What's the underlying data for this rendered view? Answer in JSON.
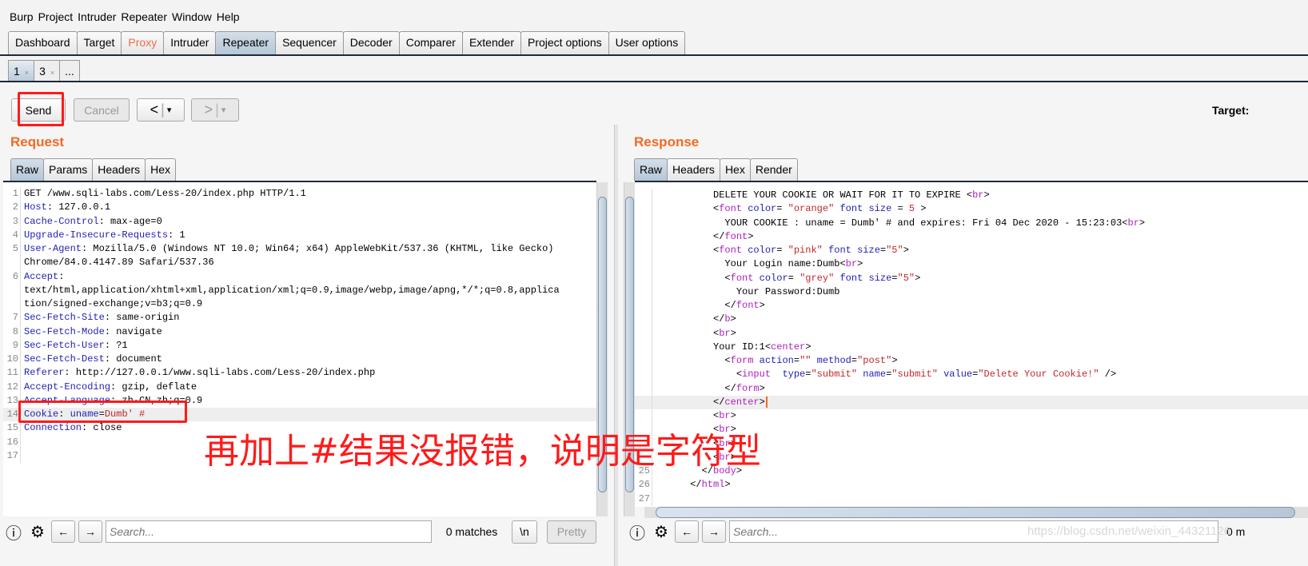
{
  "menu": [
    "Burp",
    "Project",
    "Intruder",
    "Repeater",
    "Window",
    "Help"
  ],
  "main_tabs": [
    {
      "label": "Dashboard"
    },
    {
      "label": "Target"
    },
    {
      "label": "Proxy",
      "color": "#f26b4a"
    },
    {
      "label": "Intruder"
    },
    {
      "label": "Repeater",
      "active": true
    },
    {
      "label": "Sequencer"
    },
    {
      "label": "Decoder"
    },
    {
      "label": "Comparer"
    },
    {
      "label": "Extender"
    },
    {
      "label": "Project options"
    },
    {
      "label": "User options"
    }
  ],
  "repeater_tabs": [
    {
      "label": "1",
      "close": "×"
    },
    {
      "label": "3",
      "close": "×"
    },
    {
      "label": "..."
    }
  ],
  "toolbar": {
    "send": "Send",
    "cancel": "Cancel",
    "back": "<",
    "forward": ">",
    "dropdown": "▾",
    "target_label": "Target: "
  },
  "request": {
    "title": "Request",
    "tabs": [
      "Raw",
      "Params",
      "Headers",
      "Hex"
    ],
    "lines": [
      {
        "n": "1",
        "seg": [
          [
            "GET /www.sqli-labs.com/Less-20/index.php HTTP/1.1",
            "t"
          ]
        ]
      },
      {
        "n": "2",
        "seg": [
          [
            "Host",
            "k"
          ],
          [
            ": 127.0.0.1",
            "t"
          ]
        ]
      },
      {
        "n": "3",
        "seg": [
          [
            "Cache-Control",
            "k"
          ],
          [
            ": max-age=0",
            "t"
          ]
        ]
      },
      {
        "n": "4",
        "seg": [
          [
            "Upgrade-Insecure-Requests",
            "k"
          ],
          [
            ": 1",
            "t"
          ]
        ]
      },
      {
        "n": "5",
        "seg": [
          [
            "User-Agent",
            "k"
          ],
          [
            ": Mozilla/5.0 (Windows NT 10.0; Win64; x64) AppleWebKit/537.36 (KHTML, like Gecko)",
            "t"
          ]
        ]
      },
      {
        "n": "",
        "seg": [
          [
            "Chrome/84.0.4147.89 Safari/537.36",
            "t"
          ]
        ]
      },
      {
        "n": "6",
        "seg": [
          [
            "Accept",
            "k"
          ],
          [
            ":",
            "t"
          ]
        ]
      },
      {
        "n": "",
        "seg": [
          [
            "text/html,application/xhtml+xml,application/xml;q=0.9,image/webp,image/apng,*/*;q=0.8,applica",
            "t"
          ]
        ]
      },
      {
        "n": "",
        "seg": [
          [
            "tion/signed-exchange;v=b3;q=0.9",
            "t"
          ]
        ]
      },
      {
        "n": "7",
        "seg": [
          [
            "Sec-Fetch-Site",
            "k"
          ],
          [
            ": same-origin",
            "t"
          ]
        ]
      },
      {
        "n": "8",
        "seg": [
          [
            "Sec-Fetch-Mode",
            "k"
          ],
          [
            ": navigate",
            "t"
          ]
        ]
      },
      {
        "n": "9",
        "seg": [
          [
            "Sec-Fetch-User",
            "k"
          ],
          [
            ": ?1",
            "t"
          ]
        ]
      },
      {
        "n": "10",
        "seg": [
          [
            "Sec-Fetch-Dest",
            "k"
          ],
          [
            ": document",
            "t"
          ]
        ]
      },
      {
        "n": "11",
        "seg": [
          [
            "Referer",
            "k"
          ],
          [
            ": http://127.0.0.1/www.sqli-labs.com/Less-20/index.php",
            "t"
          ]
        ]
      },
      {
        "n": "12",
        "seg": [
          [
            "Accept-Encoding",
            "k"
          ],
          [
            ": gzip, deflate",
            "t"
          ]
        ]
      },
      {
        "n": "13",
        "seg": [
          [
            "Accept-Language",
            "k"
          ],
          [
            ": zh-CN,zh;q=0.9",
            "t"
          ]
        ]
      },
      {
        "n": "14",
        "hl": true,
        "seg": [
          [
            "Cookie",
            "k"
          ],
          [
            ": ",
            "t"
          ],
          [
            "uname",
            "k"
          ],
          [
            "=",
            "t"
          ],
          [
            "Dumb' #",
            "v"
          ]
        ]
      },
      {
        "n": "15",
        "seg": [
          [
            "Connection",
            "k"
          ],
          [
            ": close",
            "t"
          ]
        ]
      },
      {
        "n": "16",
        "seg": []
      },
      {
        "n": "17",
        "seg": []
      }
    ]
  },
  "response": {
    "title": "Response",
    "tabs": [
      "Raw",
      "Headers",
      "Hex",
      "Render"
    ],
    "lines": [
      {
        "n": "",
        "seg": [
          [
            "          DELETE YOUR COOKIE OR WAIT FOR IT TO EXPIRE <",
            "t"
          ],
          [
            "br",
            "g"
          ],
          [
            ">",
            "t"
          ]
        ]
      },
      {
        "n": "",
        "seg": [
          [
            "          <",
            "t"
          ],
          [
            "font",
            "g"
          ],
          [
            " ",
            "t"
          ],
          [
            "color",
            "k"
          ],
          [
            "= ",
            "t"
          ],
          [
            "\"orange\"",
            "v"
          ],
          [
            " ",
            "t"
          ],
          [
            "font size",
            "k"
          ],
          [
            " = ",
            "t"
          ],
          [
            "5",
            "v"
          ],
          [
            " >",
            "t"
          ]
        ]
      },
      {
        "n": "",
        "seg": [
          [
            "            YOUR COOKIE : uname = Dumb' # and expires: Fri 04 Dec 2020 - 15:23:03<",
            "t"
          ],
          [
            "br",
            "g"
          ],
          [
            ">",
            "t"
          ]
        ]
      },
      {
        "n": "",
        "seg": [
          [
            "          </",
            "t"
          ],
          [
            "font",
            "g"
          ],
          [
            ">",
            "t"
          ]
        ]
      },
      {
        "n": "",
        "seg": [
          [
            "          <",
            "t"
          ],
          [
            "font",
            "g"
          ],
          [
            " ",
            "t"
          ],
          [
            "color",
            "k"
          ],
          [
            "= ",
            "t"
          ],
          [
            "\"pink\"",
            "v"
          ],
          [
            " ",
            "t"
          ],
          [
            "font size",
            "k"
          ],
          [
            "=",
            "t"
          ],
          [
            "\"5\"",
            "v"
          ],
          [
            ">",
            "t"
          ]
        ]
      },
      {
        "n": "",
        "seg": [
          [
            "            Your Login name:Dumb<",
            "t"
          ],
          [
            "br",
            "g"
          ],
          [
            ">",
            "t"
          ]
        ]
      },
      {
        "n": "",
        "seg": [
          [
            "            <",
            "t"
          ],
          [
            "font",
            "g"
          ],
          [
            " ",
            "t"
          ],
          [
            "color",
            "k"
          ],
          [
            "= ",
            "t"
          ],
          [
            "\"grey\"",
            "v"
          ],
          [
            " ",
            "t"
          ],
          [
            "font size",
            "k"
          ],
          [
            "=",
            "t"
          ],
          [
            "\"5\"",
            "v"
          ],
          [
            ">",
            "t"
          ]
        ]
      },
      {
        "n": "",
        "seg": [
          [
            "              Your Password:Dumb",
            "t"
          ]
        ]
      },
      {
        "n": "",
        "seg": [
          [
            "            </",
            "t"
          ],
          [
            "font",
            "g"
          ],
          [
            ">",
            "t"
          ]
        ]
      },
      {
        "n": "",
        "seg": [
          [
            "          </",
            "t"
          ],
          [
            "b",
            "g"
          ],
          [
            ">",
            "t"
          ]
        ]
      },
      {
        "n": "",
        "seg": [
          [
            "          <",
            "t"
          ],
          [
            "br",
            "g"
          ],
          [
            ">",
            "t"
          ]
        ]
      },
      {
        "n": "",
        "seg": [
          [
            "          Your ID:1<",
            "t"
          ],
          [
            "center",
            "g"
          ],
          [
            ">",
            "t"
          ]
        ]
      },
      {
        "n": "",
        "seg": [
          [
            "            <",
            "t"
          ],
          [
            "form",
            "g"
          ],
          [
            " ",
            "t"
          ],
          [
            "action",
            "k"
          ],
          [
            "=",
            "t"
          ],
          [
            "\"\"",
            "v"
          ],
          [
            " ",
            "t"
          ],
          [
            "method",
            "k"
          ],
          [
            "=",
            "t"
          ],
          [
            "\"post\"",
            "v"
          ],
          [
            ">",
            "t"
          ]
        ]
      },
      {
        "n": "",
        "seg": [
          [
            "              <",
            "t"
          ],
          [
            "input",
            "g"
          ],
          [
            "  ",
            "t"
          ],
          [
            "type",
            "k"
          ],
          [
            "=",
            "t"
          ],
          [
            "\"submit\"",
            "v"
          ],
          [
            " ",
            "t"
          ],
          [
            "name",
            "k"
          ],
          [
            "=",
            "t"
          ],
          [
            "\"submit\"",
            "v"
          ],
          [
            " ",
            "t"
          ],
          [
            "value",
            "k"
          ],
          [
            "=",
            "t"
          ],
          [
            "\"Delete Your Cookie!\"",
            "v"
          ],
          [
            " />",
            "t"
          ]
        ]
      },
      {
        "n": "",
        "seg": [
          [
            "            </",
            "t"
          ],
          [
            "form",
            "g"
          ],
          [
            ">",
            "t"
          ]
        ]
      },
      {
        "n": "",
        "hl": true,
        "seg": [
          [
            "          </",
            "t"
          ],
          [
            "center",
            "g"
          ],
          [
            ">",
            "t"
          ]
        ]
      },
      {
        "n": "",
        "seg": [
          [
            "          <",
            "t"
          ],
          [
            "br",
            "g"
          ],
          [
            ">",
            "t"
          ]
        ]
      },
      {
        "n": "",
        "seg": [
          [
            "          <",
            "t"
          ],
          [
            "br",
            "g"
          ],
          [
            ">",
            "t"
          ]
        ]
      },
      {
        "n": "",
        "seg": [
          [
            "          <",
            "t"
          ],
          [
            "br",
            "g"
          ],
          [
            ">",
            "t"
          ]
        ]
      },
      {
        "n": "",
        "seg": [
          [
            "          <",
            "t"
          ],
          [
            "br",
            "g"
          ],
          [
            ">",
            "t"
          ]
        ]
      },
      {
        "n": "25",
        "seg": [
          [
            "        </",
            "t"
          ],
          [
            "body",
            "g"
          ],
          [
            ">",
            "t"
          ]
        ]
      },
      {
        "n": "26",
        "seg": [
          [
            "      </",
            "t"
          ],
          [
            "html",
            "g"
          ],
          [
            ">",
            "t"
          ]
        ]
      },
      {
        "n": "27",
        "seg": []
      }
    ]
  },
  "bottom_left": {
    "search_placeholder": "Search...",
    "matches": "0 matches",
    "newline": "\\n",
    "pretty": "Pretty"
  },
  "bottom_right": {
    "search_placeholder": "Search...",
    "matches": "0 m"
  },
  "annotation": "再加上#结果没报错，说明是字符型",
  "watermark": "https://blog.csdn.net/weixin_44321126",
  "colors": {
    "accent_orange": "#f26b22",
    "annotation_red": "#ff1a1a"
  }
}
